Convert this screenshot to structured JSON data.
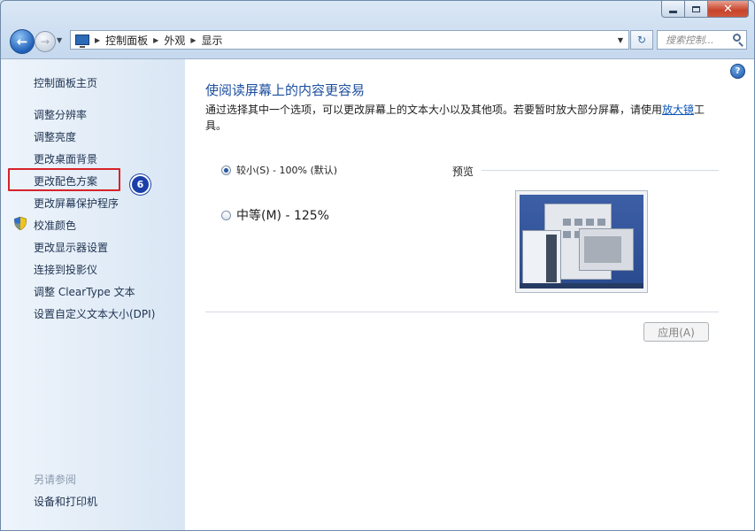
{
  "window": {
    "caption": {
      "minimize": "",
      "maximize": "",
      "close": "✕"
    }
  },
  "navigation": {
    "back_glyph": "←",
    "forward_glyph": "→",
    "history_drop": "▼",
    "breadcrumb": [
      "控制面板",
      "外观",
      "显示"
    ],
    "crumb_separator": "▶",
    "address_drop": "▼",
    "refresh_glyph": "↻",
    "search_placeholder": "搜索控制..."
  },
  "sidebar": {
    "home": "控制面板主页",
    "links": [
      "调整分辨率",
      "调整亮度",
      "更改桌面背景",
      "更改配色方案",
      "更改屏幕保护程序",
      "校准颜色",
      "更改显示器设置",
      "连接到投影仪",
      "调整 ClearType 文本",
      "设置自定义文本大小(DPI)"
    ],
    "see_also": "另请参阅",
    "see_also_links": [
      "设备和打印机"
    ],
    "annotation_badge": "6"
  },
  "main": {
    "help": "?",
    "title": "使阅读屏幕上的内容更容易",
    "description_before": "通过选择其中一个选项，可以更改屏幕上的文本大小以及其他项。若要暂时放大部分屏幕，请使用",
    "description_link": "放大镜",
    "description_after": "工具。",
    "options": [
      {
        "label": "较小(S) - 100% (默认)",
        "checked": true
      },
      {
        "label": "中等(M) - 125%",
        "checked": false
      }
    ],
    "preview_label": "预览",
    "apply_label": "应用(A)"
  }
}
